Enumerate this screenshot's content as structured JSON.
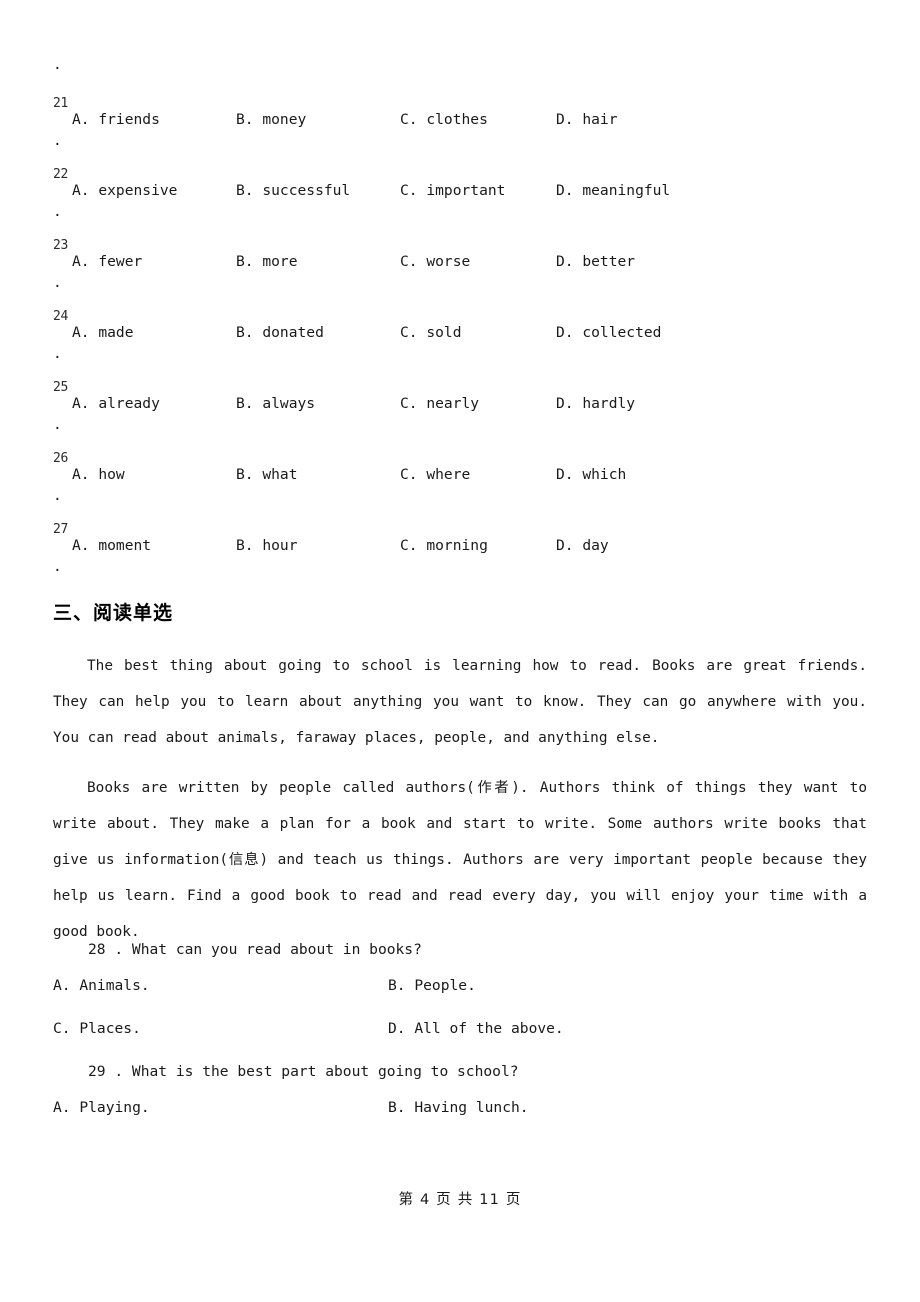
{
  "page": {
    "orphan_mark": ".",
    "footer": "第 4 页 共 11 页"
  },
  "cloze": {
    "rows": [
      {
        "number": "21",
        "dot": ".",
        "options": [
          {
            "label": "A. friends"
          },
          {
            "label": "B. money"
          },
          {
            "label": "C. clothes"
          },
          {
            "label": "D. hair"
          }
        ]
      },
      {
        "number": "22",
        "dot": ".",
        "options": [
          {
            "label": "A. expensive"
          },
          {
            "label": "B. successful"
          },
          {
            "label": "C. important"
          },
          {
            "label": "D. meaningful"
          }
        ]
      },
      {
        "number": "23",
        "dot": ".",
        "options": [
          {
            "label": "A. fewer"
          },
          {
            "label": "B. more"
          },
          {
            "label": "C. worse"
          },
          {
            "label": "D. better"
          }
        ]
      },
      {
        "number": "24",
        "dot": ".",
        "options": [
          {
            "label": "A. made"
          },
          {
            "label": "B. donated"
          },
          {
            "label": "C. sold"
          },
          {
            "label": "D. collected"
          }
        ]
      },
      {
        "number": "25",
        "dot": ".",
        "options": [
          {
            "label": "A. already"
          },
          {
            "label": "B. always"
          },
          {
            "label": "C. nearly"
          },
          {
            "label": "D. hardly"
          }
        ]
      },
      {
        "number": "26",
        "dot": ".",
        "options": [
          {
            "label": "A. how"
          },
          {
            "label": "B. what"
          },
          {
            "label": "C. where"
          },
          {
            "label": "D. which"
          }
        ]
      },
      {
        "number": "27",
        "dot": ".",
        "options": [
          {
            "label": "A. moment"
          },
          {
            "label": "B. hour"
          },
          {
            "label": "C. morning"
          },
          {
            "label": "D. day"
          }
        ]
      }
    ]
  },
  "reading": {
    "heading": "三、阅读单选",
    "paragraphs": [
      "The best thing about going to school is learning how to read. Books are great friends. They can help you to learn about anything you want to know. They can go anywhere with you. You can read about animals, faraway places, people, and anything else.",
      "Books are written by people called authors(作者). Authors think of things they want to write about. They make a plan for a book and start to write. Some authors write books that give us information(信息) and teach us things. Authors are very important people because they help us learn. Find a good book to read and read every day, you will enjoy your time with a good book."
    ],
    "questions": [
      {
        "stem": "28 . What can you read about in books?",
        "options": [
          {
            "label": "A. Animals."
          },
          {
            "label": "B. People."
          },
          {
            "label": "C. Places."
          },
          {
            "label": "D. All of the above."
          }
        ]
      },
      {
        "stem": "29 . What is the best part about going to school?",
        "options": [
          {
            "label": "A. Playing."
          },
          {
            "label": "B. Having lunch."
          }
        ]
      }
    ]
  }
}
